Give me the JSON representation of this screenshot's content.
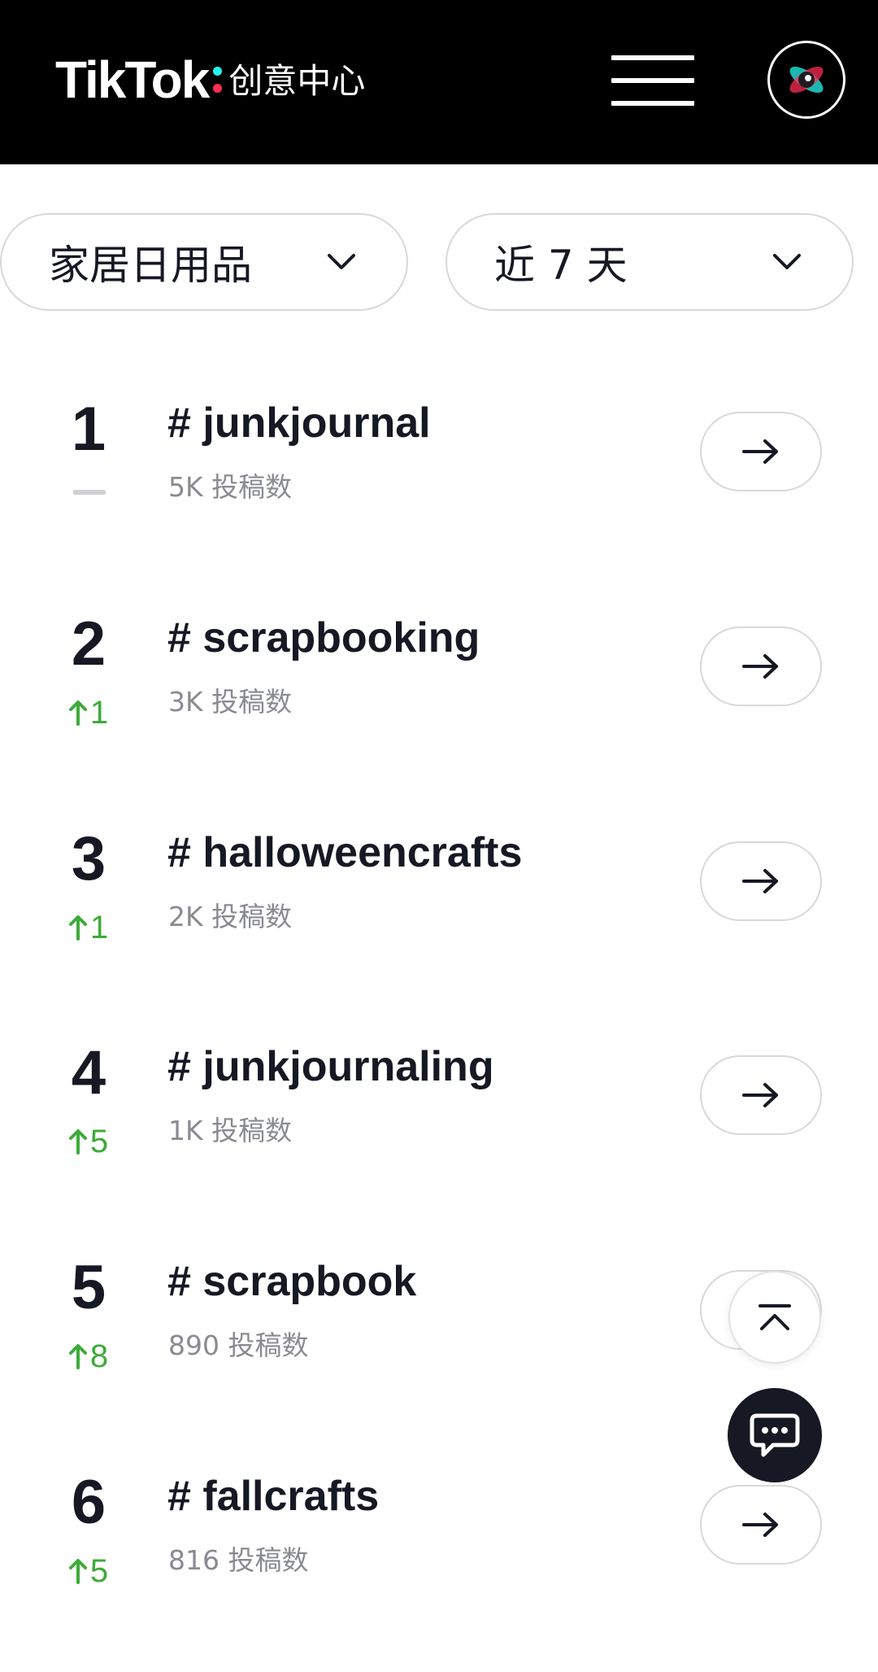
{
  "header": {
    "logo_word": "TikTok",
    "logo_sub": "创意中心",
    "menu_icon": "hamburger-menu-icon",
    "avatar_icon": "creative-center-avatar-icon",
    "colors": {
      "background": "#000000",
      "accent_cyan": "#25f4ee",
      "accent_pink": "#fe2c55"
    }
  },
  "filters": {
    "category": "家居日用品",
    "period": "近 7 天",
    "dropdown_icon": "chevron-down-icon"
  },
  "ranking": {
    "items": [
      {
        "rank": "1",
        "trend": "none",
        "change": "",
        "tag": "# junkjournal",
        "posts": "5K 投稿数"
      },
      {
        "rank": "2",
        "trend": "up",
        "change": "1",
        "tag": "# scrapbooking",
        "posts": "3K 投稿数"
      },
      {
        "rank": "3",
        "trend": "up",
        "change": "1",
        "tag": "# halloweencrafts",
        "posts": "2K 投稿数"
      },
      {
        "rank": "4",
        "trend": "up",
        "change": "5",
        "tag": "# junkjournaling",
        "posts": "1K 投稿数"
      },
      {
        "rank": "5",
        "trend": "up",
        "change": "8",
        "tag": "# scrapbook",
        "posts": "890 投稿数"
      },
      {
        "rank": "6",
        "trend": "up",
        "change": "5",
        "tag": "# fallcrafts",
        "posts": "816 投稿数"
      }
    ],
    "up_color": "#3eaa3a",
    "arrow_icon": "arrow-right-icon"
  },
  "floating": {
    "to_top_icon": "back-to-top-icon",
    "chat_icon": "chat-bubble-icon"
  }
}
